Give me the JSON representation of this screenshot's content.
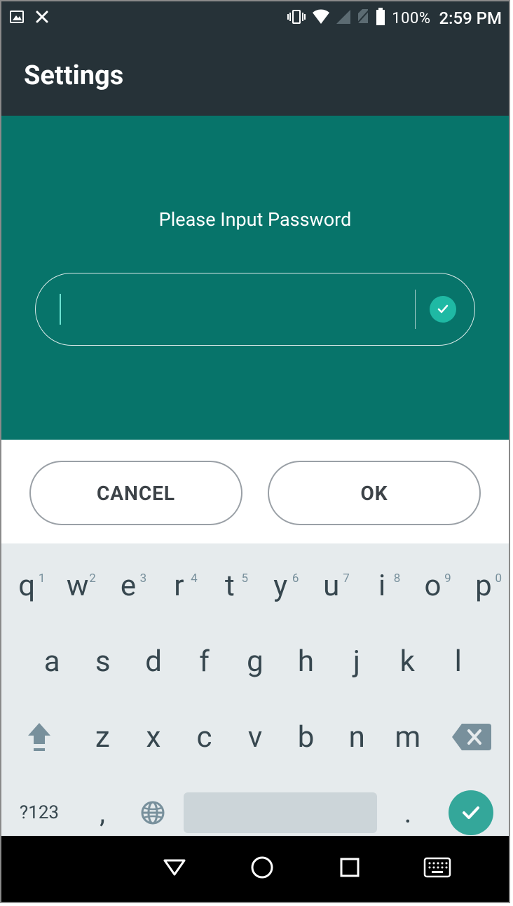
{
  "status": {
    "battery_pct": "100%",
    "time": "2:59 PM"
  },
  "appbar": {
    "title": "Settings"
  },
  "dialog": {
    "prompt": "Please Input Password",
    "password_value": "",
    "cancel": "CANCEL",
    "ok": "OK"
  },
  "keyboard": {
    "row1": [
      {
        "k": "q",
        "n": "1"
      },
      {
        "k": "w",
        "n": "2"
      },
      {
        "k": "e",
        "n": "3"
      },
      {
        "k": "r",
        "n": "4"
      },
      {
        "k": "t",
        "n": "5"
      },
      {
        "k": "y",
        "n": "6"
      },
      {
        "k": "u",
        "n": "7"
      },
      {
        "k": "i",
        "n": "8"
      },
      {
        "k": "o",
        "n": "9"
      },
      {
        "k": "p",
        "n": "0"
      }
    ],
    "row2": [
      "a",
      "s",
      "d",
      "f",
      "g",
      "h",
      "j",
      "k",
      "l"
    ],
    "row3": [
      "z",
      "x",
      "c",
      "v",
      "b",
      "n",
      "m"
    ],
    "symbols_label": "?123",
    "comma": ",",
    "period": "."
  }
}
